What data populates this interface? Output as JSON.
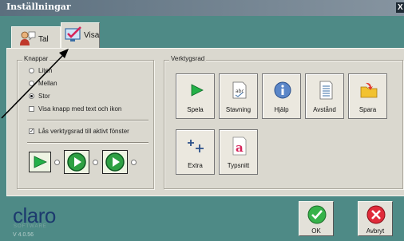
{
  "window": {
    "title": "Inställningar",
    "close_glyph": "X"
  },
  "tabs": [
    {
      "label": "Tal",
      "icon": "speaker-person-icon"
    },
    {
      "label": "Visa",
      "icon": "monitor-check-icon"
    }
  ],
  "knappar": {
    "title": "Knappar",
    "size_options": [
      {
        "label": "Liten",
        "selected": false
      },
      {
        "label": "Mellan",
        "selected": false
      },
      {
        "label": "Stor",
        "selected": true
      }
    ],
    "show_text_icon": {
      "label": "Visa knapp med text och ikon",
      "checked": false
    },
    "lock_toolbar": {
      "label": "Lås verktygsrad till aktivt fönster",
      "checked": true
    }
  },
  "verktygsrad": {
    "title": "Verktygsrad",
    "tools": [
      {
        "label": "Spela",
        "icon": "play-icon"
      },
      {
        "label": "Stavning",
        "icon": "spellcheck-icon"
      },
      {
        "label": "Hjälp",
        "icon": "info-icon"
      },
      {
        "label": "Avstånd",
        "icon": "document-spacing-icon"
      },
      {
        "label": "Spara",
        "icon": "save-folder-icon"
      },
      {
        "label": "Extra",
        "icon": "plus-extra-icon"
      },
      {
        "label": "Typsnitt",
        "icon": "font-icon"
      }
    ]
  },
  "footer": {
    "logo": "claro",
    "logo_sub": "SOFTWARE",
    "version": "V 4.0.56",
    "ok_label": "OK",
    "cancel_label": "Avbryt"
  },
  "colors": {
    "accent_green": "#2ea043",
    "background_teal": "#4e8a86",
    "panel_grey": "#dad8cf"
  }
}
